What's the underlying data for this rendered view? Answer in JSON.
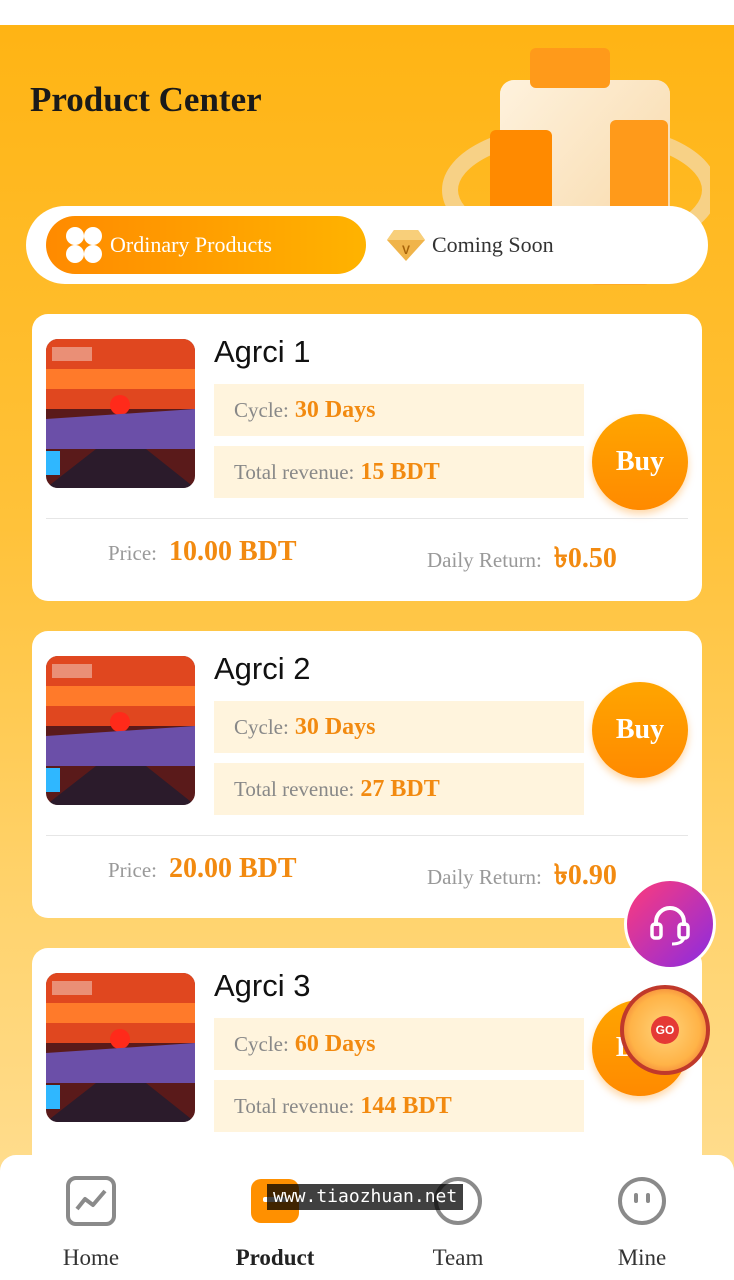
{
  "header": {
    "title": "Product Center"
  },
  "tabs": [
    {
      "label": "Ordinary Products",
      "icon": "clover-icon",
      "active": true
    },
    {
      "label": "Coming Soon",
      "icon": "diamond-icon",
      "active": false
    }
  ],
  "products": [
    {
      "name": "Agrci 1",
      "cycle_label": "Cycle:",
      "cycle_value": "30 Days",
      "revenue_label": "Total revenue:",
      "revenue_value": "15 BDT",
      "buy_label": "Buy",
      "price_label": "Price:",
      "price_value": "10.00 BDT",
      "daily_label": "Daily Return:",
      "daily_value": "৳0.50"
    },
    {
      "name": "Agrci 2",
      "cycle_label": "Cycle:",
      "cycle_value": "30 Days",
      "revenue_label": "Total revenue:",
      "revenue_value": "27 BDT",
      "buy_label": "Buy",
      "price_label": "Price:",
      "price_value": "20.00 BDT",
      "daily_label": "Daily Return:",
      "daily_value": "৳0.90"
    },
    {
      "name": "Agrci 3",
      "cycle_label": "Cycle:",
      "cycle_value": "60 Days",
      "revenue_label": "Total revenue:",
      "revenue_value": "144 BDT",
      "buy_label": "Buy"
    }
  ],
  "floating": {
    "wheel_label": "GO"
  },
  "nav": [
    {
      "label": "Home",
      "icon": "chart-icon"
    },
    {
      "label": "Product",
      "icon": "product-icon",
      "active": true
    },
    {
      "label": "Team",
      "icon": "team-icon"
    },
    {
      "label": "Mine",
      "icon": "face-icon"
    }
  ],
  "watermark": "www.tiaozhuan.net",
  "colors": {
    "accent": "#ff9a00",
    "value": "#f28a10",
    "info_bg": "#fff4dd"
  }
}
